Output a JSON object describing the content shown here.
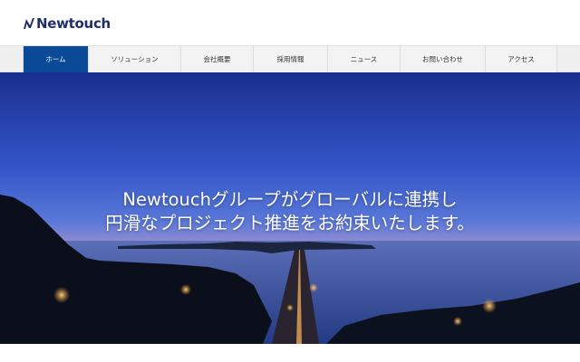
{
  "brand": {
    "name": "Newtouch",
    "color": "#1e2f6b",
    "icon": "newtouch-logo-mark"
  },
  "nav": {
    "active_color": "#0a4a96",
    "items": [
      {
        "label": "ホーム",
        "active": true
      },
      {
        "label": "ソリューション",
        "active": false
      },
      {
        "label": "会社概要",
        "active": false
      },
      {
        "label": "採用情報",
        "active": false
      },
      {
        "label": "ニュース",
        "active": false
      },
      {
        "label": "お問い合わせ",
        "active": false
      },
      {
        "label": "アクセス",
        "active": false
      }
    ]
  },
  "hero": {
    "line1": "Newtouchグループがグローバルに連携し",
    "line2": "円滑なプロジェクト推進をお約束いたします。"
  }
}
